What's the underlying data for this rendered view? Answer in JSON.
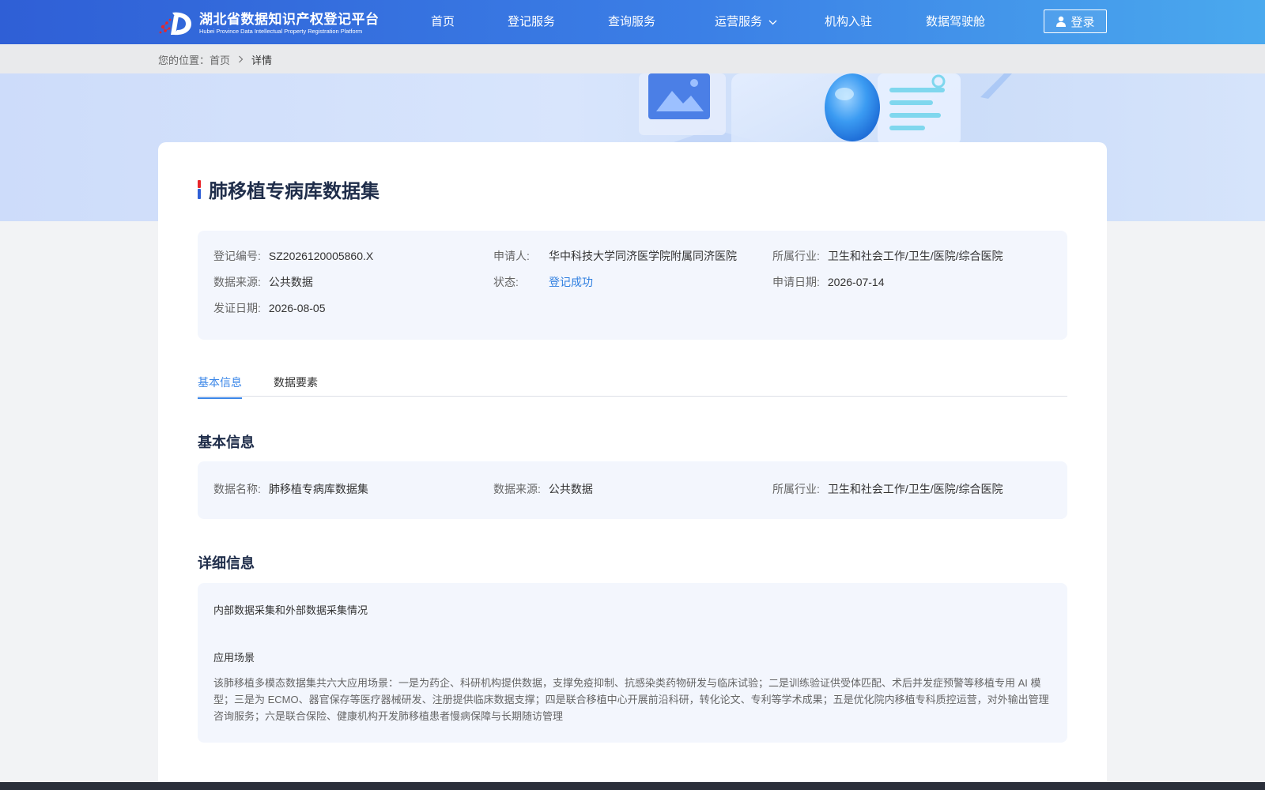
{
  "header": {
    "logo_cn": "湖北省数据知识产权登记平台",
    "logo_en": "Hubei Province Data Intellectual Property Registration Platform",
    "nav": [
      {
        "label": "首页"
      },
      {
        "label": "登记服务"
      },
      {
        "label": "查询服务"
      },
      {
        "label": "运营服务"
      },
      {
        "label": "机构入驻"
      },
      {
        "label": "数据驾驶舱"
      }
    ],
    "login_label": "登录"
  },
  "breadcrumb": {
    "prefix": "您的位置：",
    "home": "首页",
    "current": "详情"
  },
  "detail": {
    "title": "肺移植专病库数据集",
    "summary": {
      "reg_no_label": "登记编号:",
      "reg_no": "SZ2026120005860.X",
      "applicant_label": "申请人:",
      "applicant": "华中科技大学同济医学院附属同济医院",
      "industry_label": "所属行业:",
      "industry": "卫生和社会工作/卫生/医院/综合医院",
      "source_label": "数据来源:",
      "source": "公共数据",
      "status_label": "状态:",
      "status": "登记成功",
      "apply_date_label": "申请日期:",
      "apply_date": "2026-07-14",
      "issue_date_label": "发证日期:",
      "issue_date": "2026-08-05"
    },
    "tabs": [
      {
        "label": "基本信息"
      },
      {
        "label": "数据要素"
      }
    ],
    "basic": {
      "heading": "基本信息",
      "name_label": "数据名称:",
      "name": "肺移植专病库数据集",
      "source_label": "数据来源:",
      "source": "公共数据",
      "industry_label": "所属行业:",
      "industry": "卫生和社会工作/卫生/医院/综合医院"
    },
    "details": {
      "heading": "详细信息",
      "collection_heading": "内部数据采集和外部数据采集情况",
      "scenario_heading": "应用场景",
      "scenario_text": "该肺移植多模态数据集共六大应用场景：一是为药企、科研机构提供数据，支撑免疫抑制、抗感染类药物研发与临床试验；二是训练验证供受体匹配、术后并发症预警等移植专用 AI 模型；三是为 ECMO、器官保存等医疗器械研发、注册提供临床数据支撑；四是联合移植中心开展前沿科研，转化论文、专利等学术成果；五是优化院内移植专科质控运营，对外输出管理咨询服务；六是联合保险、健康机构开发肺移植患者慢病保障与长期随访管理"
    }
  },
  "colors": {
    "header_start": "#2f5fd6",
    "header_end": "#4aa9ee",
    "accent": "#3a86e8",
    "status_ok": "#2f7fe0",
    "panel_bg": "#f3f6fd"
  },
  "icons": [
    "logo-icon",
    "user-icon",
    "chevron-down-icon",
    "chevron-right-icon",
    "title-marker-icon"
  ]
}
